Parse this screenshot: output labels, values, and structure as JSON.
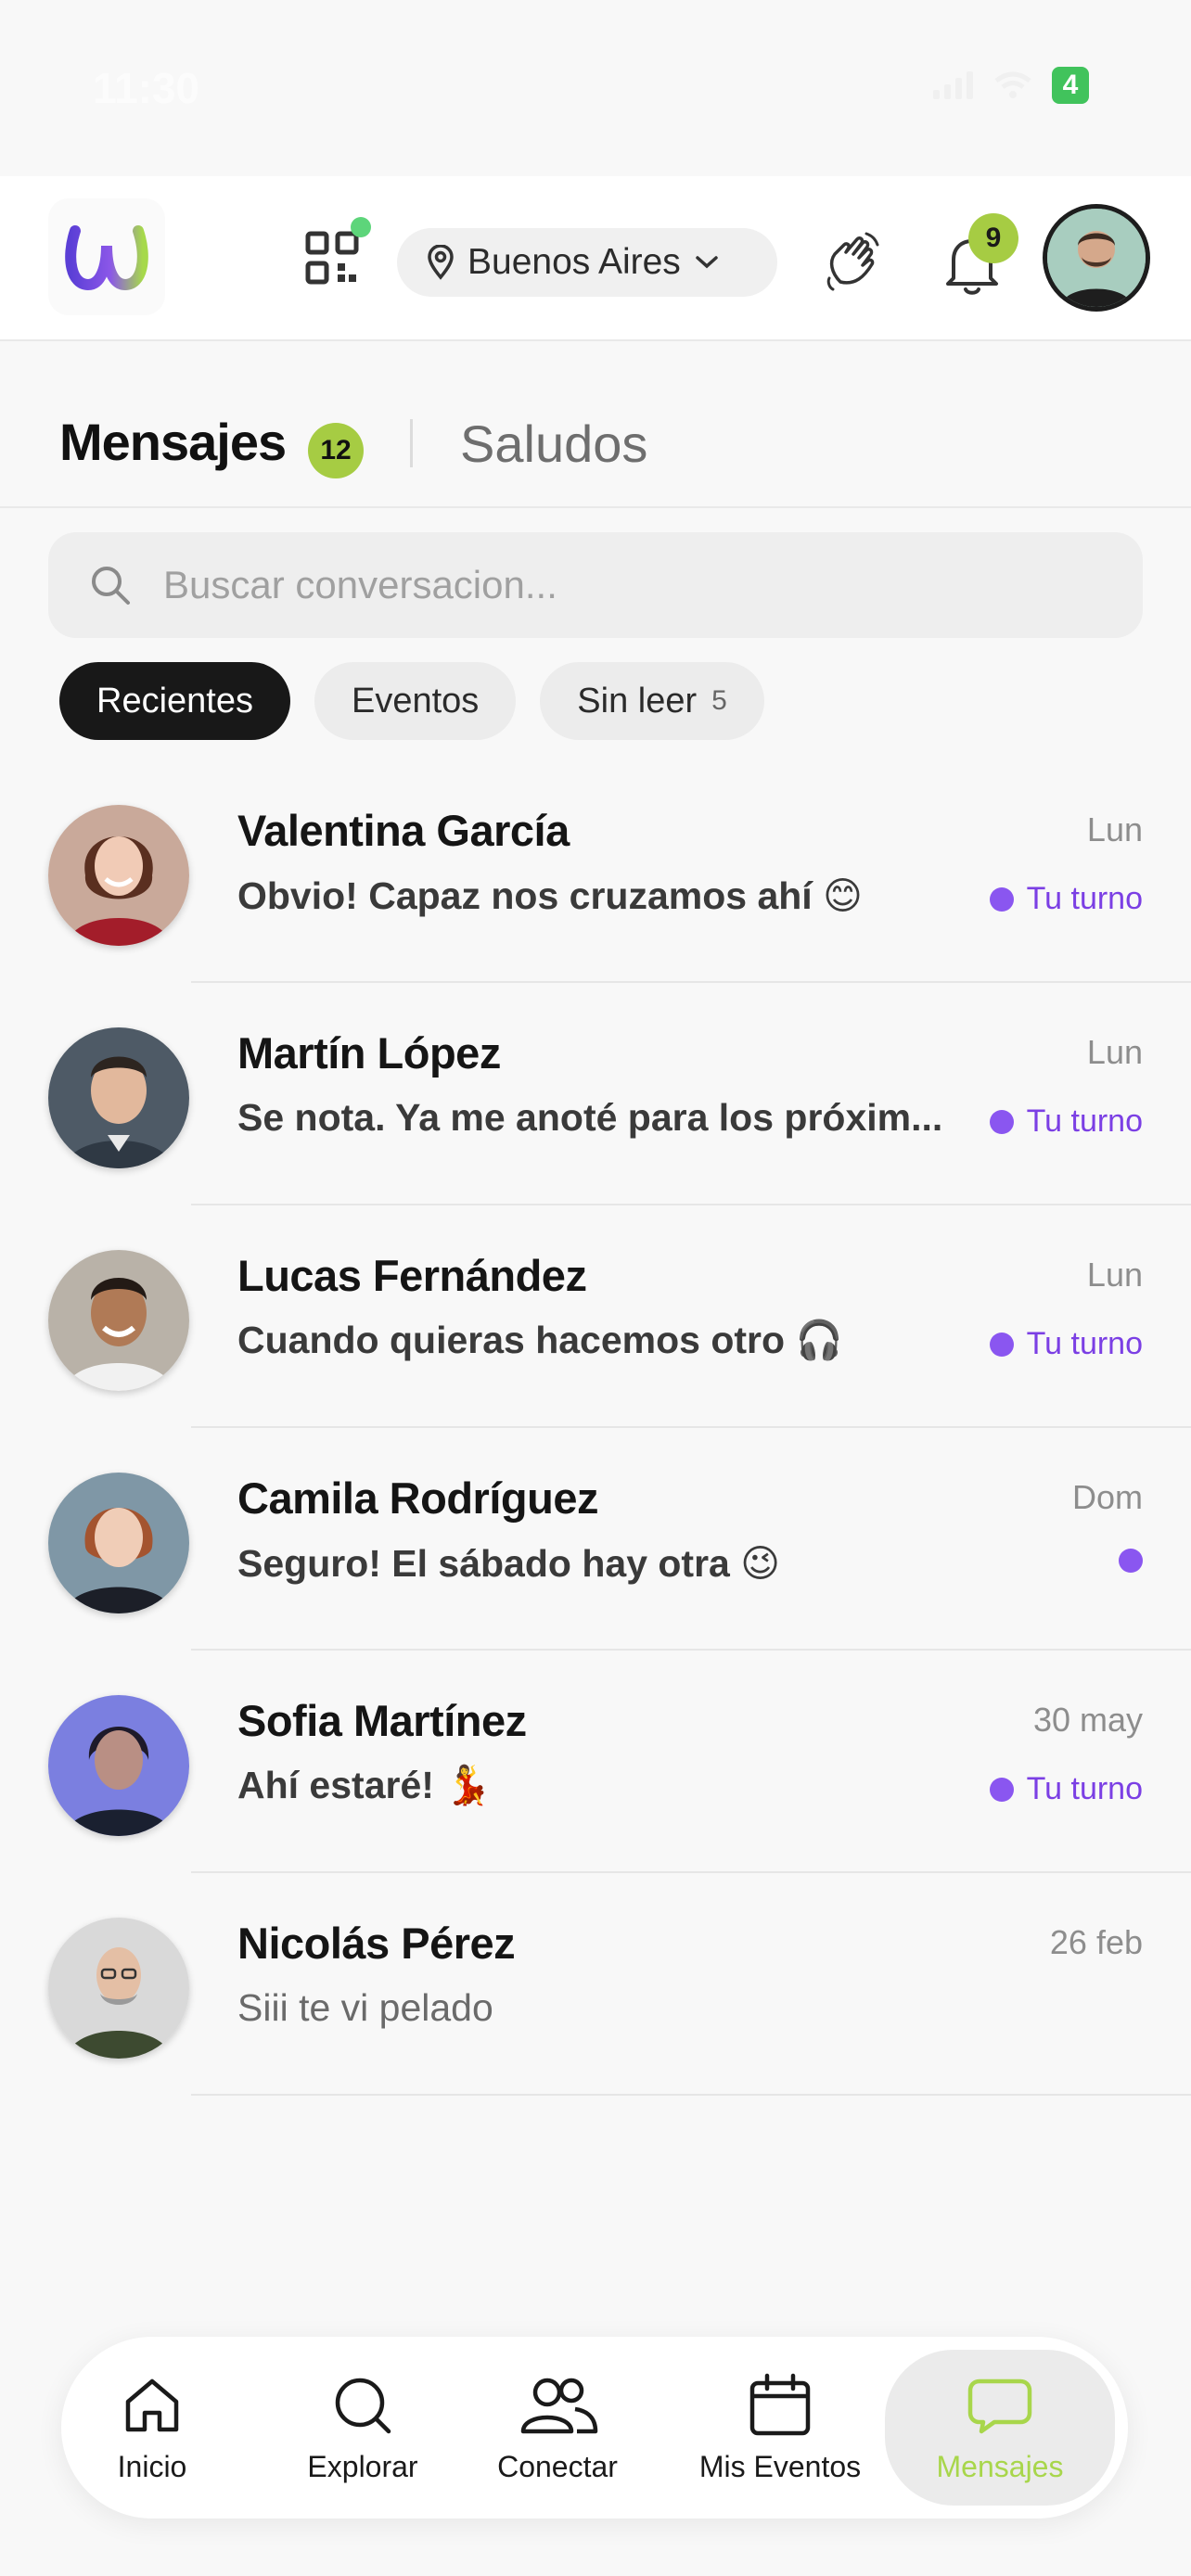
{
  "status_bar": {
    "time": "11:30",
    "battery": "4"
  },
  "header": {
    "location": "Buenos Aires",
    "notifications_count": "9",
    "colors": {
      "online_dot": "#5dd57a",
      "badge": "#a6cc43"
    }
  },
  "tabs": {
    "messages_label": "Mensajes",
    "messages_count": "12",
    "greetings_label": "Saludos"
  },
  "search": {
    "placeholder": "Buscar conversacion..."
  },
  "filters": {
    "recent": "Recientes",
    "events": "Eventos",
    "unread": "Sin leer",
    "unread_count": "5"
  },
  "conversations": [
    {
      "name": "Valentina García",
      "time": "Lun",
      "preview": "Obvio! Capaz nos cruzamos ahí 😊",
      "turn": "Tu turno",
      "unread": true
    },
    {
      "name": "Martín López",
      "time": "Lun",
      "preview": "Se nota. Ya me anoté para los próxim...",
      "turn": "Tu turno",
      "unread": true
    },
    {
      "name": "Lucas Fernández",
      "time": "Lun",
      "preview": "Cuando quieras hacemos otro 🎧",
      "turn": "Tu turno",
      "unread": true
    },
    {
      "name": "Camila Rodríguez",
      "time": "Dom",
      "preview": "Seguro! El sábado hay otra 😉",
      "turn": "",
      "unread": true
    },
    {
      "name": "Sofia Martínez",
      "time": "30 may",
      "preview": "Ahí estaré! 💃",
      "turn": "Tu turno",
      "unread": true
    },
    {
      "name": "Nicolás Pérez",
      "time": "26 feb",
      "preview": "Siii te vi pelado",
      "turn": "",
      "unread": false
    }
  ],
  "bottom_nav": {
    "home": "Inicio",
    "explore": "Explorar",
    "connect": "Conectar",
    "events": "Mis Eventos",
    "messages": "Mensajes",
    "colors": {
      "active": "#a8d64b",
      "turn": "#7b3fe4"
    }
  }
}
